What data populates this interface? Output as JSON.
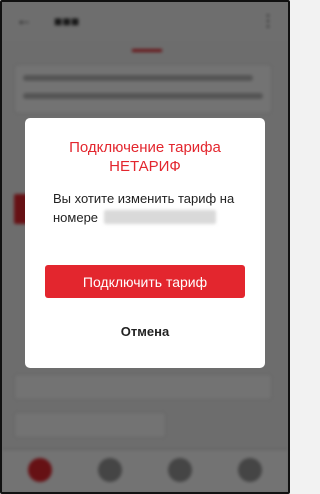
{
  "dialog": {
    "title_line1": "Подключение тарифа",
    "title_line2": "НЕТАРИФ",
    "message": "Вы хотите изменить тариф на номере",
    "confirm_label": "Подключить тариф",
    "cancel_label": "Отмена"
  },
  "colors": {
    "accent": "#e3262e",
    "overlay": "rgba(0,0,0,0.55)"
  }
}
